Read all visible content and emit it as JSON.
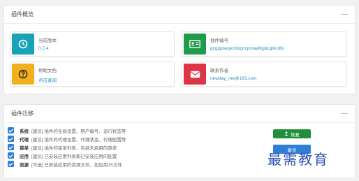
{
  "overview": {
    "title": "插件概览",
    "collapse": "—",
    "cards": [
      {
        "label": "当前版本",
        "value": "0.2.4",
        "icon": "clock-icon",
        "color": "#19a2b8"
      },
      {
        "label": "插件编号",
        "value": "gcgigdaopcmbpncpmaafkgbcglncdbi",
        "icon": "id-card-icon",
        "color": "#1f9b4b"
      },
      {
        "label": "帮助文档",
        "value": "点击查阅",
        "icon": "question-icon",
        "color": "#f2b01c"
      },
      {
        "label": "联系作者",
        "value": "newday_me@163.com",
        "icon": "mail-icon",
        "color": "#dd3545"
      }
    ]
  },
  "migration": {
    "title": "插件迁移",
    "collapse": "—",
    "items": [
      {
        "name": "系统",
        "desc": "[建议] 插件的全局设置、用户编号、运行状态等",
        "checked": true
      },
      {
        "name": "代理",
        "desc": "[建议] 插件的代理设置、代理状态、代理配置等",
        "checked": true
      },
      {
        "name": "菜单",
        "desc": "[建议] 插件的菜单列表，包括未启用的菜单",
        "checked": true
      },
      {
        "name": "应用",
        "desc": "[建议] 已安装应用列表和已安装应用的配置",
        "checked": true
      },
      {
        "name": "资源",
        "desc": "[可选] 已安装应用的资源文件，如应用JS文件",
        "checked": true
      }
    ],
    "restore_label": "恢复",
    "second_label": "备份"
  },
  "watermark": "最需教育"
}
